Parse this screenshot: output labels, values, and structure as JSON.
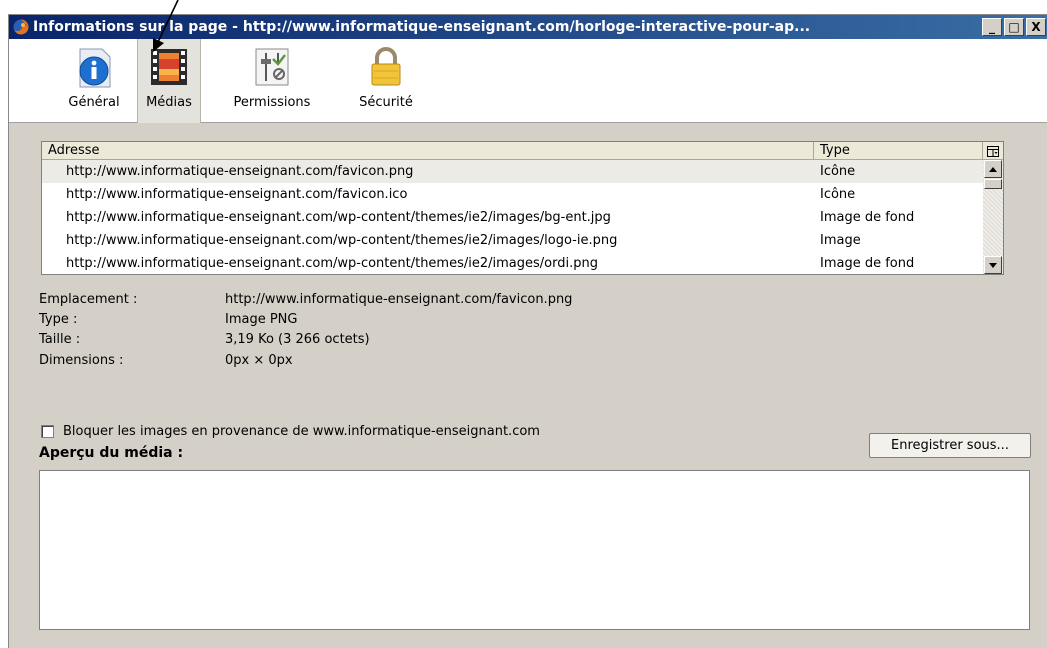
{
  "window": {
    "title": "Informations sur la page - http://www.informatique-enseignant.com/horloge-interactive-pour-ap...",
    "minimize": "_",
    "maximize": "□",
    "close": "X"
  },
  "toolbar": {
    "items": [
      {
        "label": "Général",
        "icon": "info-icon"
      },
      {
        "label": "Médias",
        "icon": "media-icon",
        "selected": true
      },
      {
        "label": "Permissions",
        "icon": "permissions-icon"
      },
      {
        "label": "Sécurité",
        "icon": "lock-icon"
      }
    ]
  },
  "media_list": {
    "columns": [
      "Adresse",
      "Type"
    ],
    "rows": [
      {
        "address": "http://www.informatique-enseignant.com/favicon.png",
        "type": "Icône"
      },
      {
        "address": "http://www.informatique-enseignant.com/favicon.ico",
        "type": "Icône"
      },
      {
        "address": "http://www.informatique-enseignant.com/wp-content/themes/ie2/images/bg-ent.jpg",
        "type": "Image de fond"
      },
      {
        "address": "http://www.informatique-enseignant.com/wp-content/themes/ie2/images/logo-ie.png",
        "type": "Image"
      },
      {
        "address": "http://www.informatique-enseignant.com/wp-content/themes/ie2/images/ordi.png",
        "type": "Image de fond"
      }
    ],
    "selected_row": 0
  },
  "properties": [
    {
      "label": "Emplacement :",
      "value": "http://www.informatique-enseignant.com/favicon.png"
    },
    {
      "label": "Type :",
      "value": "Image PNG"
    },
    {
      "label": "Taille :",
      "value": "3,19 Ko (3 266 octets)"
    },
    {
      "label": "Dimensions :",
      "value": "0px × 0px"
    }
  ],
  "block_checkbox": {
    "label": "Bloquer les images en provenance de www.informatique-enseignant.com",
    "checked": false
  },
  "save_button": "Enregistrer sous...",
  "preview_title": "Aperçu du média :"
}
